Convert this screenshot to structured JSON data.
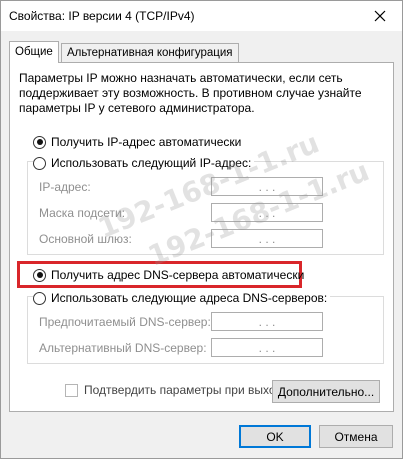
{
  "window": {
    "title": "Свойства: IP версии 4 (TCP/IPv4)",
    "close_icon": "close-icon"
  },
  "tabs": [
    {
      "label": "Общие",
      "active": true
    },
    {
      "label": "Альтернативная конфигурация",
      "active": false
    }
  ],
  "description": {
    "line1": "Параметры IP можно назначать автоматически, если сеть",
    "line2": "поддерживает эту возможность. В противном случае узнайте",
    "line3": "параметры IP у сетевого администратора."
  },
  "ip_section": {
    "auto_label": "Получить IP-адрес автоматически",
    "auto_checked": true,
    "manual_label": "Использовать следующий IP-адрес:",
    "manual_checked": false,
    "fields": [
      {
        "label": "IP-адрес:",
        "value": ".   .   ."
      },
      {
        "label": "Маска подсети:",
        "value": ".   .   ."
      },
      {
        "label": "Основной шлюз:",
        "value": ".   .   ."
      }
    ]
  },
  "dns_section": {
    "auto_label": "Получить адрес DNS-сервера автоматически",
    "auto_checked": true,
    "manual_label": "Использовать следующие адреса DNS-серверов:",
    "manual_checked": false,
    "fields": [
      {
        "label": "Предпочитаемый DNS-сервер:",
        "value": ".   .   ."
      },
      {
        "label": "Альтернативный DNS-сервер:",
        "value": ".   .   ."
      }
    ]
  },
  "validate_label": "Подтвердить параметры при выходе",
  "buttons": {
    "advanced": "Дополнительно...",
    "ok": "OK",
    "cancel": "Отмена"
  },
  "watermark": {
    "line1": "192-168-1-1.ru",
    "line2": "192-168-1-1.ru"
  },
  "colors": {
    "highlight": "#d9262a",
    "default_button_border": "#0078d7"
  }
}
